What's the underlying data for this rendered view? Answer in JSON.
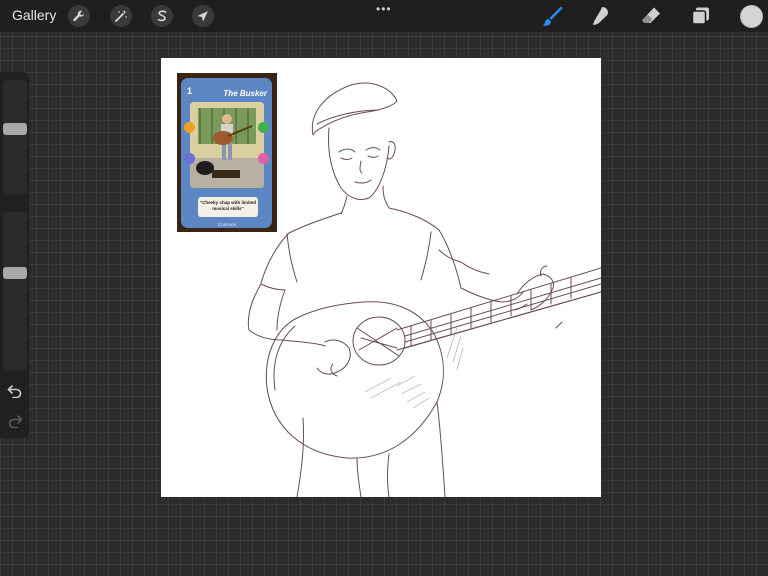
{
  "topbar": {
    "gallery_label": "Gallery",
    "left_tools": [
      {
        "name": "actions",
        "icon": "wrench-icon"
      },
      {
        "name": "adjustments",
        "icon": "magic-wand-icon"
      },
      {
        "name": "selection",
        "icon": "selection-s-icon"
      },
      {
        "name": "transform",
        "icon": "arrow-cursor-icon"
      }
    ],
    "more_label": "•••",
    "right_tools": [
      {
        "name": "brush",
        "icon": "brush-icon",
        "active": true,
        "color": "#2f8cf5"
      },
      {
        "name": "smudge",
        "icon": "smudge-finger-icon",
        "active": false
      },
      {
        "name": "eraser",
        "icon": "eraser-icon",
        "active": false
      },
      {
        "name": "layers",
        "icon": "layers-icon",
        "active": false
      }
    ],
    "current_color": "#d4d4d4"
  },
  "sidebar": {
    "brush_size_level": 0.58,
    "opacity_level": 0.62,
    "undo_icon": "undo-arrow-icon",
    "redo_icon": "redo-arrow-icon"
  },
  "canvas": {
    "background": "#ffffff",
    "sketch_color": "#6b4a58",
    "reference_card": {
      "number": "1",
      "title": "The Busker",
      "description": "\"Cheeky chap with limited musical skills\"",
      "rarity": "Common",
      "frame_color": "#5c86c4"
    }
  }
}
